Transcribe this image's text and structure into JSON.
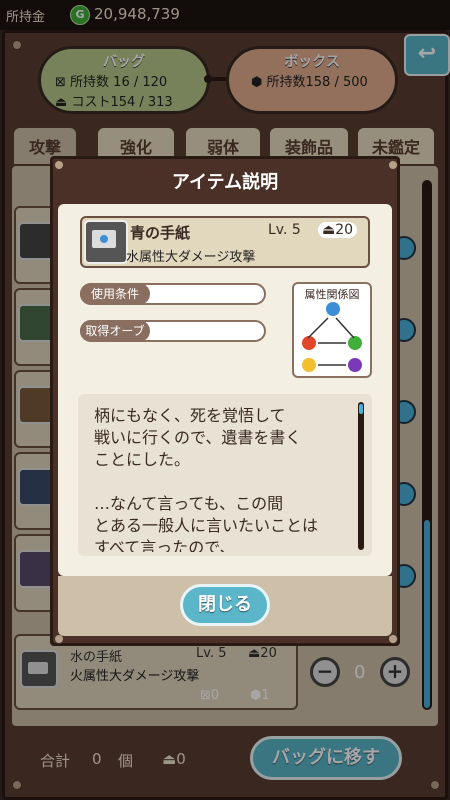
{
  "header": {
    "money_label": "所持金",
    "coin_symbol": "G",
    "money": "20,948,739"
  },
  "bag": {
    "title": "バッグ",
    "count": "所持数 16 / 120",
    "cost": "コスト154 / 313"
  },
  "box": {
    "title": "ボックス",
    "count": "所持数158 / 500"
  },
  "tabs": [
    {
      "label": "攻撃"
    },
    {
      "label": "強化"
    },
    {
      "label": "弱体"
    },
    {
      "label": "装飾品"
    },
    {
      "label": "未鑑定"
    }
  ],
  "visible_row": {
    "name": "水の手紙",
    "level": "Lv. 5",
    "cost": "20",
    "desc": "火属性大ダメージ攻撃",
    "bag_count": "0",
    "box_count": "1",
    "qty": "0"
  },
  "footer": {
    "total_label": "合計",
    "total_value": "0",
    "unit": "個",
    "cost_total": "0",
    "move_button": "バッグに移す"
  },
  "modal": {
    "title": "アイテム説明",
    "item_name": "青の手紙",
    "item_level": "Lv. 5",
    "item_cost": "20",
    "item_desc": "水属性大ダメージ攻撃",
    "use_condition_label": "使用条件",
    "orb_label": "取得オーブ",
    "element_chart_title": "属性関係図",
    "flavor_lines": [
      "柄にもなく、死を覚悟して",
      "戦いに行くので、遺書を書く",
      "ことにした。",
      "",
      "…なんて言っても、この間",
      "とある一般人に言いたいことは",
      "すべて言ったので、"
    ],
    "close_button": "閉じる"
  },
  "colors": {
    "accent": "#5ab6c8",
    "frame": "#5a3e32",
    "bag": "#b8c88a",
    "box": "#e2ac8e"
  }
}
